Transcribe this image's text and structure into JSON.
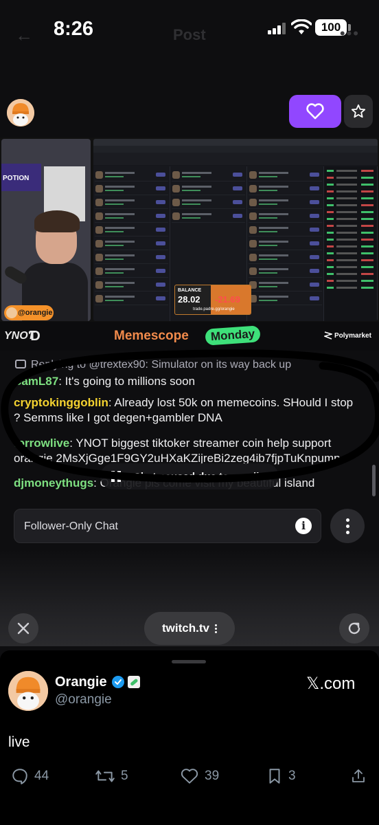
{
  "status_bar": {
    "time": "8:26",
    "battery": "100"
  },
  "ghost_header": {
    "back": "←",
    "title": "Post",
    "more": "•••"
  },
  "stream": {
    "follow_icon": "heart-icon",
    "star_icon": "star-icon",
    "video": {
      "cam_banner": "POTION",
      "cam_tag": "@orangie",
      "balance_label": "BALANCE",
      "balance_value": "28.02",
      "balance_change": "-21.69",
      "balance_link": "trade.padre.gg/orangie",
      "footer_title": "Memescope",
      "footer_badge": "Monday",
      "footer_sponsor": "Polymarket",
      "footer_logo_left": "YNOT"
    }
  },
  "chat": {
    "reply_to": "Replying to @trextex90: Simulator on its way back up",
    "messages": [
      {
        "user": "SamL87",
        "user_color": "#7ee081",
        "text": ": It's going to millions soon"
      },
      {
        "user": "cryptokinggoblin",
        "user_color": "#f5d330",
        "text": ": Already lost 50k on memecoins. SHould I stop ? Semms like I got degen+gambler DNA"
      },
      {
        "user": "torrowlive",
        "user_color": "#7ee081",
        "text": ": YNOT biggest tiktoker streamer coin help support orangie 2MsXjGge1F9GY2uHXaKZijreBi2zeg4ib7fjpTuKnpump"
      },
      {
        "user": "djmoneythugs",
        "user_color": "#7ee081",
        "text": ": Orangie pls come visit my beautiful island"
      }
    ],
    "paused_label": "Chat paused due to scroll",
    "input_placeholder": "Follower-Only Chat",
    "info_icon": "i"
  },
  "browser": {
    "url": "twitch.tv"
  },
  "post": {
    "author_name": "Orangie",
    "author_handle": "@orangie",
    "source": "𝕏.com",
    "text": "live",
    "actions": {
      "replies": "44",
      "reposts": "5",
      "likes": "39",
      "bookmarks": "3"
    }
  },
  "colors": {
    "twitch_purple": "#9147ff",
    "annotation": "#000000",
    "muted": "#8b98a5",
    "verified": "#1d9bf0"
  }
}
